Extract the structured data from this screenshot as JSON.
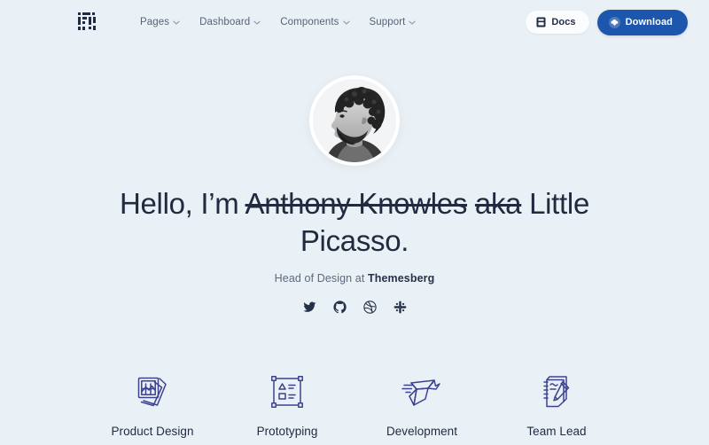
{
  "theme": {
    "background": "#eaf1f6",
    "text_dark": "#212a3e",
    "text_muted": "#57627a",
    "accent_blue": "#1c56ad",
    "icon_indigo": "#3d4290",
    "card_white": "#fbfcfe"
  },
  "navbar": {
    "brand_icon": "pixel-blocks-logo-icon",
    "links": [
      {
        "label": "Pages",
        "icon": "chevron-down-icon"
      },
      {
        "label": "Dashboard",
        "icon": "chevron-down-icon"
      },
      {
        "label": "Components",
        "icon": "chevron-down-icon"
      },
      {
        "label": "Support",
        "icon": "chevron-down-icon"
      }
    ],
    "docs_button": {
      "label": "Docs",
      "icon": "book-icon"
    },
    "download_button": {
      "label": "Download",
      "icon": "cloud-download-icon"
    }
  },
  "hero": {
    "avatar_icon": "profile-portrait-avatar",
    "headline": {
      "lead": "Hello, I’m ",
      "struck_name": "Anthony Knowles",
      "struck_aka": "aka",
      "trail": " Little Picasso."
    },
    "subtitle": {
      "prefix": "Head of Design at ",
      "company": "Themesberg"
    },
    "socials": [
      {
        "name": "twitter",
        "label": "Twitter"
      },
      {
        "name": "github",
        "label": "GitHub"
      },
      {
        "name": "dribbble",
        "label": "Dribbble"
      },
      {
        "name": "slack",
        "label": "Slack"
      }
    ]
  },
  "features": [
    {
      "label": "Product Design",
      "icon": "photo-stack-icon"
    },
    {
      "label": "Prototyping",
      "icon": "wireframe-icon"
    },
    {
      "label": "Development",
      "icon": "origami-bird-icon"
    },
    {
      "label": "Team Lead",
      "icon": "notepad-pen-icon"
    }
  ]
}
